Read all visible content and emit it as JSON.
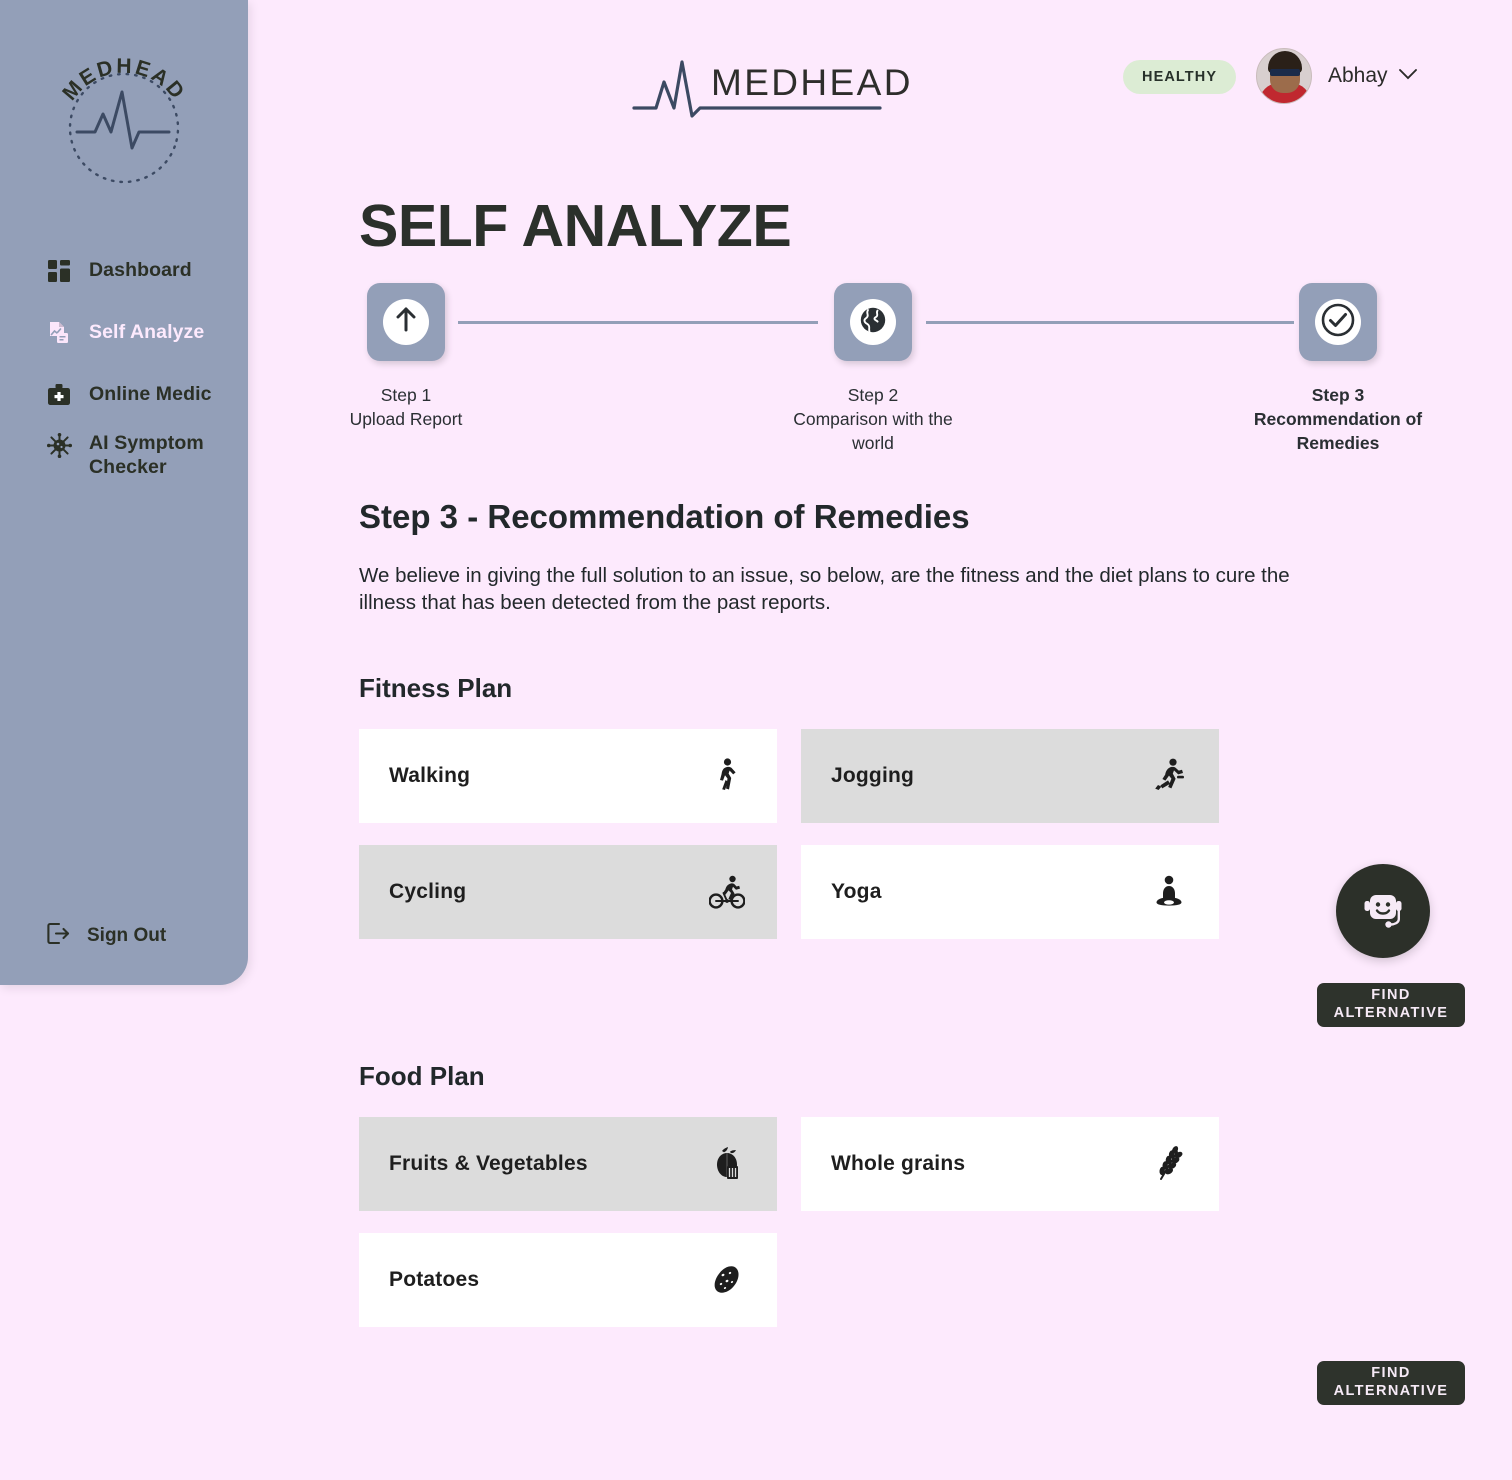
{
  "brand": {
    "name": "MEDHEAD",
    "sidebar_mark_name": "medhead-logo-badge",
    "logo_icon": "heartbeat-ecg-icon"
  },
  "sidebar": {
    "items": [
      {
        "label": "Dashboard",
        "icon": "dashboard-grid-icon",
        "active": false
      },
      {
        "label": "Self Analyze",
        "icon": "report-chart-icon",
        "active": true
      },
      {
        "label": "Online Medic",
        "icon": "medical-briefcase-icon",
        "active": false
      },
      {
        "label": "AI Symptom Checker",
        "icon": "virus-icon",
        "active": false
      }
    ],
    "sign_out": {
      "label": "Sign Out",
      "icon": "logout-arrow-icon"
    }
  },
  "header": {
    "status_badge": "HEALTHY",
    "user_name": "Abhay",
    "caret_icon": "chevron-down-icon",
    "avatar_icon": "user-avatar"
  },
  "page": {
    "title": "SELF ANALYZE",
    "section_heading": "Step 3 - Recommendation of Remedies",
    "section_description": "We believe in giving the full solution to an issue, so below, are the fitness and the diet plans to cure the illness that has been detected from the past reports."
  },
  "stepper": {
    "steps": [
      {
        "number": "Step 1",
        "caption": "Upload Report",
        "icon": "upload-arrow-icon",
        "current": false
      },
      {
        "number": "Step 2",
        "caption": "Comparison with the world",
        "icon": "globe-icon",
        "current": false
      },
      {
        "number": "Step 3",
        "caption": "Recommendation of Remedies",
        "icon": "check-circle-icon",
        "current": true
      }
    ]
  },
  "fitness_plan": {
    "title": "Fitness Plan",
    "items": [
      {
        "label": "Walking",
        "icon": "walking-person-icon",
        "style": "light"
      },
      {
        "label": "Jogging",
        "icon": "running-person-icon",
        "style": "shade"
      },
      {
        "label": "Cycling",
        "icon": "cyclist-icon",
        "style": "shade"
      },
      {
        "label": "Yoga",
        "icon": "meditation-icon",
        "style": "light"
      }
    ],
    "find_alternative": {
      "line1": "FIND",
      "line2": "ALTERNATIVE"
    }
  },
  "food_plan": {
    "title": "Food Plan",
    "items": [
      {
        "label": "Fruits & Vegetables",
        "icon": "apple-icon",
        "style": "shade"
      },
      {
        "label": "Whole grains",
        "icon": "wheat-icon",
        "style": "light"
      },
      {
        "label": "Potatoes",
        "icon": "potato-icon",
        "style": "light"
      }
    ],
    "find_alternative": {
      "line1": "FIND",
      "line2": "ALTERNATIVE"
    }
  },
  "chatbot": {
    "icon": "chatbot-robot-icon"
  },
  "colors": {
    "background": "#fdeafd",
    "sidebar": "#939fb8",
    "accent_dark": "#2e332c",
    "card_shade": "#dcdcdc",
    "card_light": "#ffffff",
    "badge_healthy": "#dcecd4"
  }
}
